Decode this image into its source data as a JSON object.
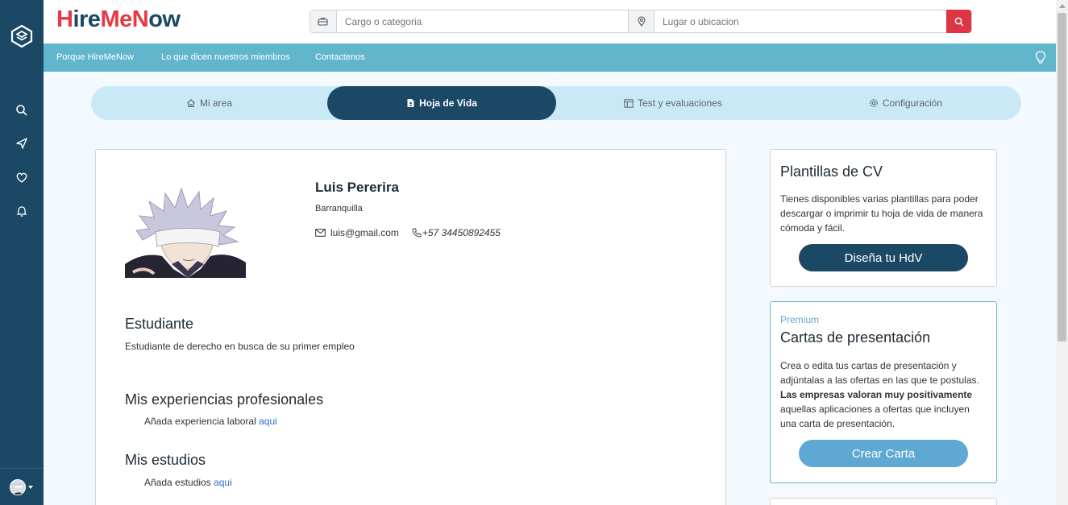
{
  "brand": {
    "part1": "H",
    "part2": "ire",
    "part3": "Me",
    "part4": "N",
    "part5": "ow"
  },
  "search": {
    "cargo_placeholder": "Cargo o categoria",
    "lugar_placeholder": "Lugar o ubicacion"
  },
  "nav": {
    "links": [
      "Porque HireMeNow",
      "Lo que dicen nuestros miembros",
      "Contactenos"
    ]
  },
  "tabs": [
    {
      "label": "Mi area",
      "icon": "home-icon"
    },
    {
      "label": "Hoja de Vida",
      "icon": "document-icon",
      "active": true
    },
    {
      "label": "Test y evaluaciones",
      "icon": "layout-icon"
    },
    {
      "label": "Configuración",
      "icon": "gear-icon"
    }
  ],
  "profile": {
    "name": "Luis Pererira",
    "city": "Barranquilla",
    "email": "luis@gmail.com",
    "phone": "+57 34450892455"
  },
  "sections": {
    "title1": "Estudiante",
    "text1": "Estudiante de derecho en busca de su primer empleo",
    "title2": "Mis experiencias profesionales",
    "text2": "Añada experiencia laboral",
    "link2": "aqui",
    "title3": "Mis estudios",
    "text3": "Añada estudios",
    "link3": "aqui"
  },
  "sidebar": {
    "templates": {
      "title": "Plantillas de CV",
      "text": "Tienes disponibles varias plantillas para poder descargar o imprimir tu hoja de vida de manera cómoda y fácil.",
      "button": "Diseña tu HdV"
    },
    "letters": {
      "badge": "Premium",
      "title": "Cartas de presentación",
      "text1": "Crea o edita tus cartas de presentación y adjúntalas a las ofertas en las que te postulas.",
      "bold": "Las empresas valoran muy positivamente",
      "text2": "aquellas aplicaciones a ofertas que incluyen una carta de presentación.",
      "button": "Crear Carta"
    }
  },
  "colors": {
    "primary": "#1b4965",
    "accent": "#62b6cb",
    "danger": "#dc3545",
    "tab_bg": "#cae9f7",
    "button_light": "#5fa8d3"
  }
}
